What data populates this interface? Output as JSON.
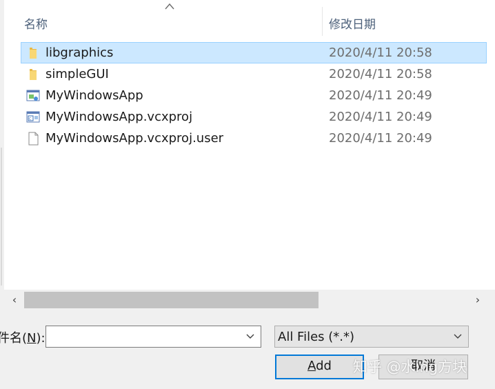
{
  "columns": {
    "name_label": "名称",
    "date_label": "修改日期"
  },
  "files": [
    {
      "name": "libgraphics",
      "date": "2020/4/11 20:58",
      "icon": "folder-icon",
      "selected": true
    },
    {
      "name": "simpleGUI",
      "date": "2020/4/11 20:58",
      "icon": "folder-icon",
      "selected": false
    },
    {
      "name": "MyWindowsApp",
      "date": "2020/4/11 20:49",
      "icon": "vs-solution-icon",
      "selected": false
    },
    {
      "name": "MyWindowsApp.vcxproj",
      "date": "2020/4/11 20:49",
      "icon": "vc-project-icon",
      "selected": false
    },
    {
      "name": "MyWindowsApp.vcxproj.user",
      "date": "2020/4/11 20:49",
      "icon": "blank-file-icon",
      "selected": false
    }
  ],
  "file_name": {
    "label_prefix": "件名(",
    "label_key": "N",
    "label_suffix": "):",
    "value": ""
  },
  "file_type": {
    "selected": "All Files (*.*)"
  },
  "buttons": {
    "add_key": "A",
    "add_rest": "dd",
    "cancel": "取消"
  },
  "watermark": "知乎 @水ing方块",
  "colors": {
    "selection_bg": "#cce8ff",
    "selection_border": "#99d1ff",
    "accent": "#0078d7",
    "folder": "#f8d775"
  }
}
